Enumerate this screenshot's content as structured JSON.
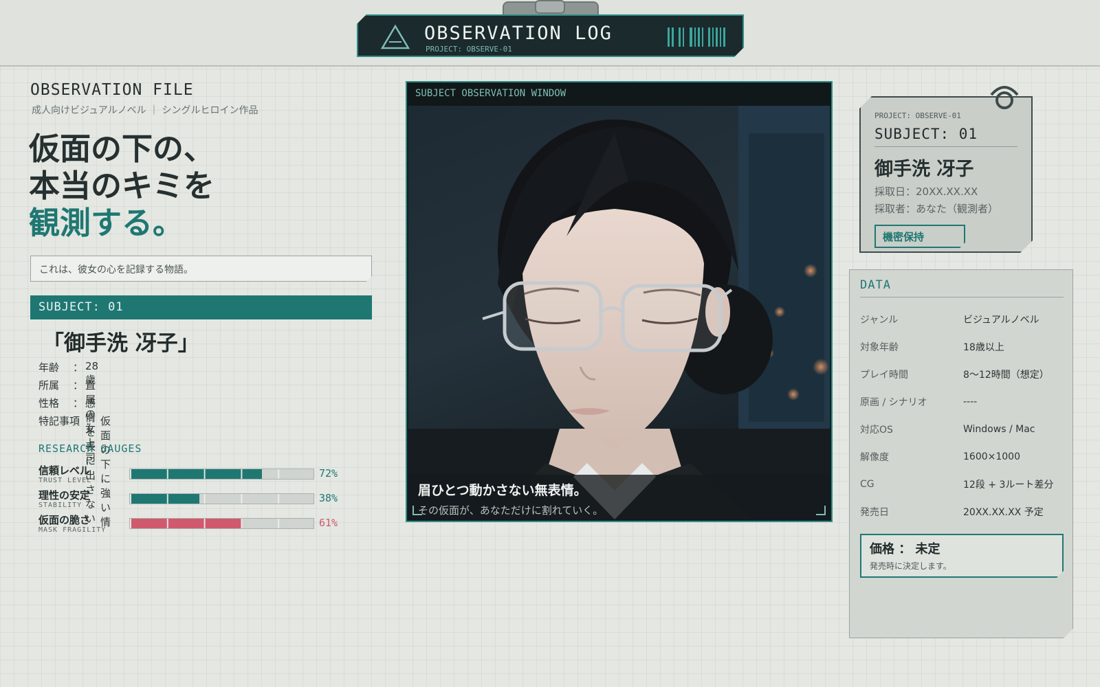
{
  "header": {
    "title": "OBSERVATION LOG",
    "project": "PROJECT: OBSERVE-01"
  },
  "left": {
    "file_label": "OBSERVATION FILE",
    "file_sub": "成人向けビジュアルノベル ｜ シングルヒロイン作品",
    "headline": [
      "仮面の下の、",
      "本当のキミを",
      "観測する。"
    ],
    "tagline": "これは、彼女の心を記録する物語。",
    "subject_band": "SUBJECT: 01",
    "heroine_name": "「御手洗 冴子」",
    "profile": [
      {
        "key": "年齢",
        "value": "28歳"
      },
      {
        "key": "所属",
        "value": "直属の女上司"
      },
      {
        "key": "性格",
        "value": "感情を表に出さない"
      },
      {
        "key": "特記事項",
        "value": "仮面の下に強い情"
      }
    ],
    "gauges_title": "RESEARCH GAUGES",
    "gauges": [
      {
        "label": "信頼レベル",
        "sub": "TRUST LEVEL",
        "value": 72,
        "display": "72%",
        "color": "#1f7772"
      },
      {
        "label": "理性の安定",
        "sub": "STABILITY",
        "value": 38,
        "display": "38%",
        "color": "#1f7772"
      },
      {
        "label": "仮面の脆さ",
        "sub": "MASK FRAGILITY",
        "value": 61,
        "display": "61%",
        "color": "#d0596e"
      }
    ]
  },
  "window": {
    "title": "SUBJECT OBSERVATION WINDOW",
    "caption_main": "眉ひとつ動かさない無表情。",
    "caption_sub": "その仮面が、あなただけに割れていく。"
  },
  "card": {
    "project": "PROJECT: OBSERVE-01",
    "subject": "SUBJECT: 01",
    "name": "御手洗 冴子",
    "date": "採取日：20XX.XX.XX",
    "collector": "採取者：あなた（観測者）",
    "badge": "機密保持"
  },
  "data": {
    "title": "DATA",
    "rows": [
      {
        "key": "ジャンル",
        "value": "ビジュアルノベル"
      },
      {
        "key": "対象年齢",
        "value": "18歳以上"
      },
      {
        "key": "プレイ時間",
        "value": "8～12時間（想定）"
      },
      {
        "key": "原画 / シナリオ",
        "value": "----"
      },
      {
        "key": "対応OS",
        "value": "Windows / Mac"
      },
      {
        "key": "解像度",
        "value": "1600×1000"
      },
      {
        "key": "CG",
        "value": "12段 + 3ルート差分"
      },
      {
        "key": "発売日",
        "value": "20XX.XX.XX 予定"
      }
    ],
    "price_label": "価格 ： 未定",
    "price_note": "発売時に決定します。"
  },
  "colors": {
    "accent": "#1f7772",
    "danger": "#d0596e",
    "dark": "#1b2a2c"
  }
}
